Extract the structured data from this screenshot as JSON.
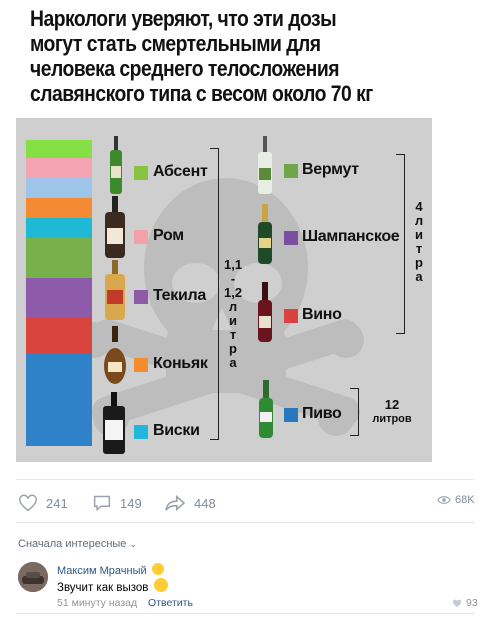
{
  "post": {
    "title_lines": [
      "Наркологи уверяют, что эти дозы",
      "могут стать смертельными для",
      "человека среднего телосложения",
      "славянского типа с весом около 70 кг"
    ]
  },
  "infographic": {
    "left_drinks": [
      {
        "label": "Абсент",
        "color": "#8ac342"
      },
      {
        "label": "Ром",
        "color": "#f4a0a8"
      },
      {
        "label": "Текила",
        "color": "#8e5aa8"
      },
      {
        "label": "Коньяк",
        "color": "#f58c2c"
      },
      {
        "label": "Виски",
        "color": "#21b7d9"
      }
    ],
    "right_drinks": [
      {
        "label": "Вермут",
        "color": "#70a64a"
      },
      {
        "label": "Шампанское",
        "color": "#7a4fa0"
      },
      {
        "label": "Вино",
        "color": "#d9413f"
      },
      {
        "label": "Пиво",
        "color": "#2978be"
      }
    ],
    "stack_colors": [
      "#84e044",
      "#f4a3b3",
      "#9fc4ea",
      "#f48a34",
      "#1fb9d6",
      "#78b04c",
      "#8e5aaa",
      "#d9443f",
      "#2f82c7"
    ],
    "left_volume_lines": [
      "1,1",
      "-",
      "1,2",
      "л",
      "и",
      "т",
      "р",
      "а"
    ],
    "right_volume_lines": [
      "4",
      "л",
      "и",
      "т",
      "р",
      "а"
    ],
    "beer_volume": {
      "number": "12",
      "unit": "литров"
    }
  },
  "actions": {
    "likes": "241",
    "comments": "149",
    "shares": "448",
    "views": "68K"
  },
  "comments_section": {
    "sort_label": "Сначала интересные",
    "comment": {
      "author": "Максим Мрачный",
      "text": "Звучит как вызов",
      "time": "51 минуту назад",
      "reply": "Ответить",
      "likes": "93"
    }
  }
}
